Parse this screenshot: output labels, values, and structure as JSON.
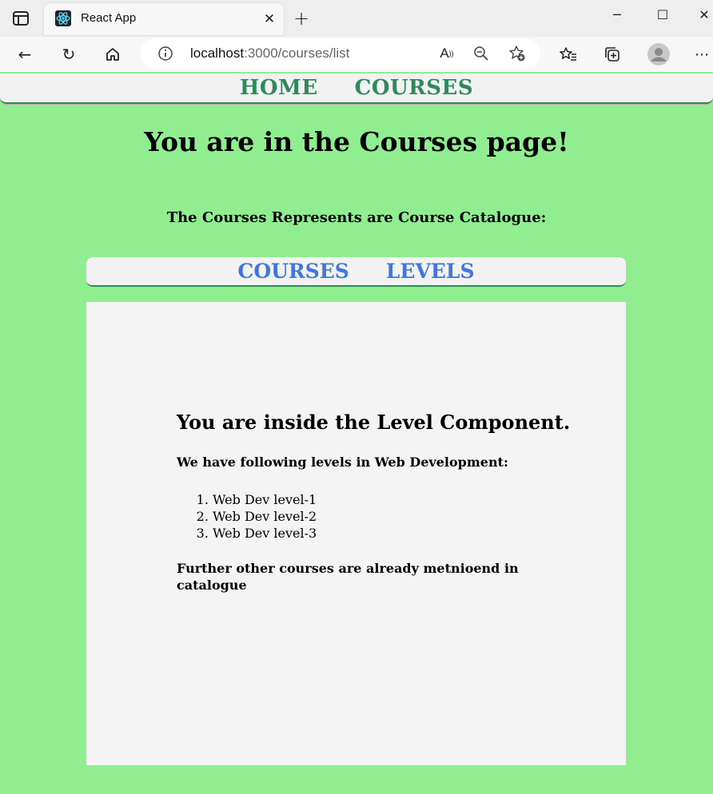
{
  "browser": {
    "tab_title": "React App",
    "url_host": "localhost",
    "url_path": ":3000/courses/list"
  },
  "topnav": {
    "home": "HOME",
    "courses": "COURSES"
  },
  "page": {
    "title": "You are in the Courses page!",
    "subtitle": "The Courses Represents are Course Catalogue:"
  },
  "subnav": {
    "courses": "COURSES",
    "levels": "LEVELS"
  },
  "level_component": {
    "heading": "You are inside the Level Component.",
    "intro": "We have following levels in Web Development:",
    "levels": [
      "Web Dev level-1",
      "Web Dev level-2",
      "Web Dev level-3"
    ],
    "note": "Further other courses are already metnioend in catalogue"
  },
  "colors": {
    "page_bg": "#90ee90",
    "topnav_link": "#2e8b57",
    "subnav_link": "#4175e0",
    "panel_bg": "#f4f4f4"
  }
}
